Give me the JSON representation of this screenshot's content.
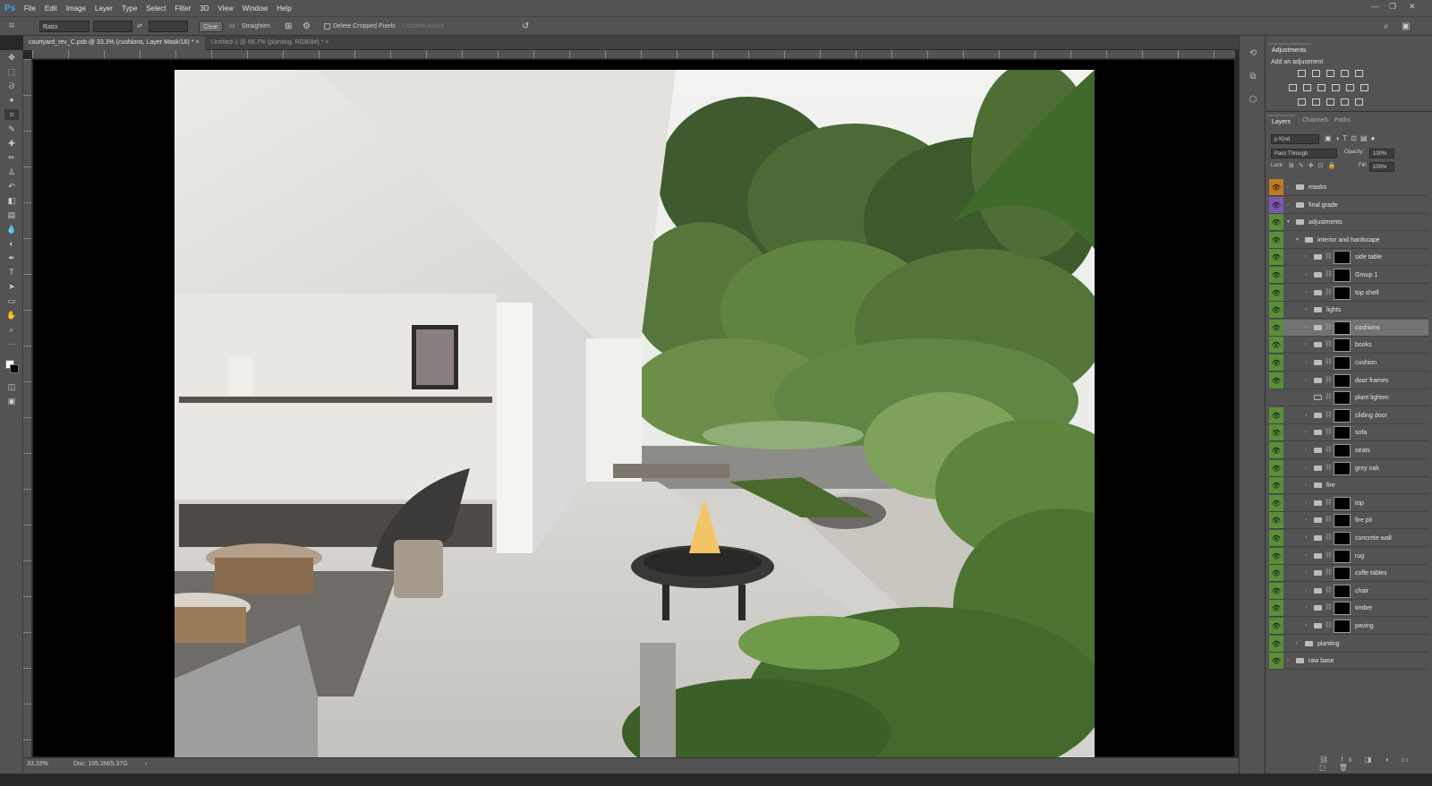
{
  "app": {
    "logo": "Ps"
  },
  "menu": [
    "File",
    "Edit",
    "Image",
    "Layer",
    "Type",
    "Select",
    "Filter",
    "3D",
    "View",
    "Window",
    "Help"
  ],
  "window_controls": {
    "minimize": "—",
    "restore": "❐",
    "close": "✕"
  },
  "options_bar": {
    "ratio_value": "Ratio",
    "width_value": "",
    "height_value": "",
    "clear_label": "Clear",
    "straighten_label": "Straighten",
    "delete_cropped_label": "Delete Cropped Pixels",
    "content_aware_label": "Content-Aware"
  },
  "document_tabs": [
    {
      "label": "courtyard_rev_C.psb @ 33.3% (cushions, Layer Mask/16) *",
      "active": true
    },
    {
      "label": "Untitled-1 @ 66.7% (planting, RGB/8#) *",
      "active": false
    }
  ],
  "status": {
    "zoom": "33.33%",
    "doc": "Doc: 105.2M/5.37G"
  },
  "panels": {
    "adjustments_tab": "Adjustments",
    "add_adjustment_label": "Add an adjustment",
    "layers_tabs": [
      "Layers",
      "Channels",
      "Paths"
    ],
    "kind_label": "ρ Kind",
    "blend_mode": "Pass Through",
    "opacity_label": "Opacity:",
    "opacity_value": "100%",
    "lock_label": "Lock:",
    "fill_label": "Fill:",
    "fill_value": "100%"
  },
  "layers": [
    {
      "name": "masks",
      "type": "group",
      "eye": "orange",
      "indent": 0,
      "mask": false
    },
    {
      "name": "final grade",
      "type": "group",
      "eye": "purple",
      "indent": 0,
      "mask": false
    },
    {
      "name": "adjustments",
      "type": "group-open",
      "eye": "green",
      "indent": 0,
      "mask": false
    },
    {
      "name": "interior and hardscape",
      "type": "group-open",
      "eye": "green",
      "indent": 1,
      "mask": false
    },
    {
      "name": "side table",
      "type": "group",
      "eye": "green",
      "indent": 2,
      "mask": true
    },
    {
      "name": "Group 1",
      "type": "group",
      "eye": "green",
      "indent": 2,
      "mask": true
    },
    {
      "name": "top shelf",
      "type": "group",
      "eye": "green",
      "indent": 2,
      "mask": true
    },
    {
      "name": "lights",
      "type": "group",
      "eye": "green",
      "indent": 2,
      "mask": false
    },
    {
      "name": "cushions",
      "type": "group",
      "eye": "green",
      "indent": 2,
      "mask": true,
      "selected": true
    },
    {
      "name": "books",
      "type": "group",
      "eye": "green",
      "indent": 2,
      "mask": true
    },
    {
      "name": "cushion",
      "type": "group",
      "eye": "green",
      "indent": 2,
      "mask": true
    },
    {
      "name": "door frames",
      "type": "group",
      "eye": "green",
      "indent": 2,
      "mask": true
    },
    {
      "name": "plant lighten",
      "type": "adjustment",
      "eye": "none",
      "indent": 2,
      "mask": true
    },
    {
      "name": "sliding door",
      "type": "group",
      "eye": "green",
      "indent": 2,
      "mask": true
    },
    {
      "name": "sofa",
      "type": "group",
      "eye": "green",
      "indent": 2,
      "mask": true
    },
    {
      "name": "seats",
      "type": "group",
      "eye": "green",
      "indent": 2,
      "mask": true
    },
    {
      "name": "grey oak",
      "type": "group",
      "eye": "green",
      "indent": 2,
      "mask": true
    },
    {
      "name": "fire",
      "type": "group",
      "eye": "green",
      "indent": 2,
      "mask": false
    },
    {
      "name": "top",
      "type": "group",
      "eye": "green",
      "indent": 2,
      "mask": true
    },
    {
      "name": "fire pit",
      "type": "group",
      "eye": "green",
      "indent": 2,
      "mask": true
    },
    {
      "name": "concrete wall",
      "type": "group",
      "eye": "green",
      "indent": 2,
      "mask": true
    },
    {
      "name": "rug",
      "type": "group",
      "eye": "green",
      "indent": 2,
      "mask": true
    },
    {
      "name": "coffe tables",
      "type": "group",
      "eye": "green",
      "indent": 2,
      "mask": true
    },
    {
      "name": "chair",
      "type": "group",
      "eye": "green",
      "indent": 2,
      "mask": true
    },
    {
      "name": "timber",
      "type": "group",
      "eye": "green",
      "indent": 2,
      "mask": true
    },
    {
      "name": "paving",
      "type": "group",
      "eye": "green",
      "indent": 2,
      "mask": true
    },
    {
      "name": "planting",
      "type": "group",
      "eye": "green",
      "indent": 1,
      "mask": false
    },
    {
      "name": "raw base",
      "type": "group",
      "eye": "green",
      "indent": 0,
      "mask": false
    }
  ],
  "colors": {
    "eye_green": "#5a8f3a",
    "eye_orange": "#c07a24",
    "eye_purple": "#7d58b0",
    "accent": "#31a8ff"
  }
}
